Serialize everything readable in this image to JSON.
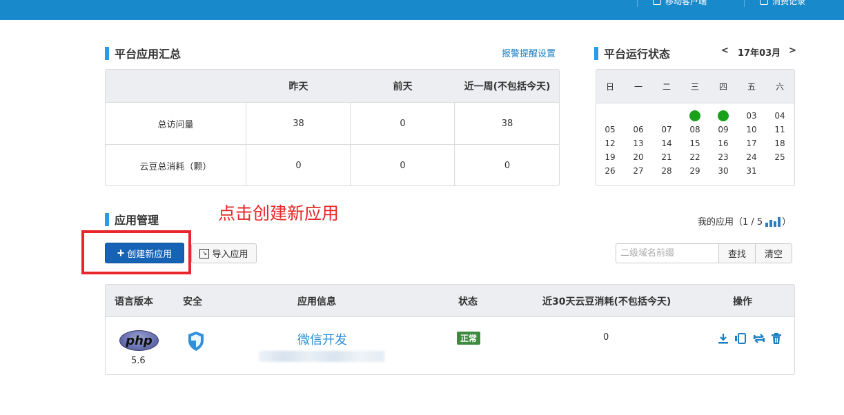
{
  "topbar": {
    "items": [
      {
        "label": "移动客户端",
        "icon": "mobile-icon"
      },
      {
        "label": "消费记录",
        "icon": "record-icon"
      }
    ]
  },
  "summary": {
    "title": "平台应用汇总",
    "alert_link": "报警提醒设置",
    "columns": [
      "",
      "昨天",
      "前天",
      "近一周(不包括今天)"
    ],
    "rows": [
      {
        "label": "总访问量",
        "values": [
          "38",
          "0",
          "38"
        ]
      },
      {
        "label": "云豆总消耗（颗）",
        "values": [
          "0",
          "0",
          "0"
        ]
      }
    ]
  },
  "calendar": {
    "title": "平台运行状态",
    "prev": "<",
    "next": ">",
    "month": "17年03月",
    "weekdays": [
      "日",
      "一",
      "二",
      "三",
      "四",
      "五",
      "六"
    ],
    "weeks": [
      [
        "",
        "",
        "",
        "",
        "",
        "03",
        "04"
      ],
      [
        "05",
        "06",
        "07",
        "08",
        "09",
        "10",
        "11"
      ],
      [
        "12",
        "13",
        "14",
        "15",
        "16",
        "17",
        "18"
      ],
      [
        "19",
        "20",
        "21",
        "22",
        "23",
        "24",
        "25"
      ],
      [
        "26",
        "27",
        "28",
        "29",
        "30",
        "31",
        ""
      ]
    ],
    "status_color": "#1aa11a"
  },
  "annotation": "点击创建新应用",
  "apps": {
    "title": "应用管理",
    "my_apps_label": "我的应用（1 / 5",
    "my_apps_close": "）",
    "create_button": "创建新应用",
    "import_button": "导入应用",
    "search_placeholder": "二级域名前缀",
    "search_button": "查找",
    "clear_button": "清空",
    "columns": [
      "语言版本",
      "安全",
      "应用信息",
      "状态",
      "近30天云豆消耗(不包括今天)",
      "操作"
    ],
    "rows": [
      {
        "language": "php",
        "version": "5.6",
        "name": "微信开发",
        "status": "正常",
        "consumption": "0"
      }
    ]
  },
  "colors": {
    "topbar": "#1889cb",
    "accent": "#2a9be8",
    "primary_button": "#1663b6",
    "status_ok": "#3e8a3e",
    "annotation": "#e62727"
  }
}
